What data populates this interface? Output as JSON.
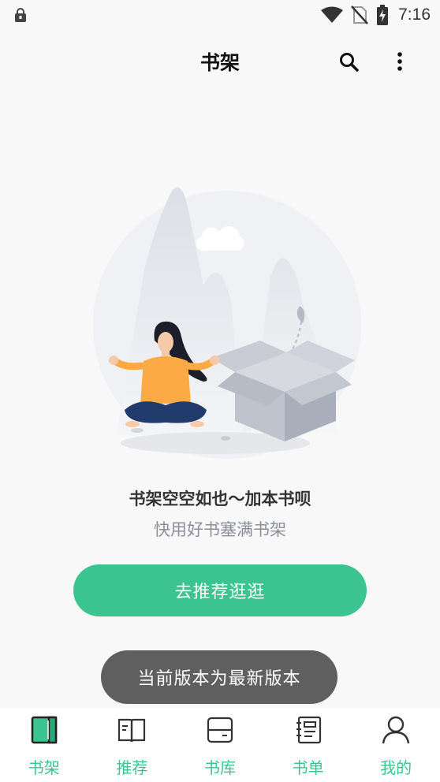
{
  "status_bar": {
    "time": "7:16",
    "icons": [
      "lock-icon",
      "wifi-icon",
      "no-sim-icon",
      "battery-charging-icon"
    ]
  },
  "header": {
    "title": "书架",
    "actions": [
      "search-icon",
      "more-vert-icon"
    ]
  },
  "empty_state": {
    "title": "书架空空如也～加本书呗",
    "subtitle": "快用好书塞满书架",
    "button_label": "去推荐逛逛"
  },
  "toast": {
    "message": "当前版本为最新版本"
  },
  "bottom_nav": {
    "active_index": 0,
    "accent_color": "#3cc490",
    "items": [
      {
        "label": "书架",
        "icon": "bookshelf-icon"
      },
      {
        "label": "推荐",
        "icon": "open-book-icon"
      },
      {
        "label": "书库",
        "icon": "library-icon"
      },
      {
        "label": "书单",
        "icon": "booklist-icon"
      },
      {
        "label": "我的",
        "icon": "profile-icon"
      }
    ]
  },
  "colors": {
    "accent": "#3cc490",
    "background": "#f8f8f8",
    "toast_bg": "#5f5f5f"
  }
}
